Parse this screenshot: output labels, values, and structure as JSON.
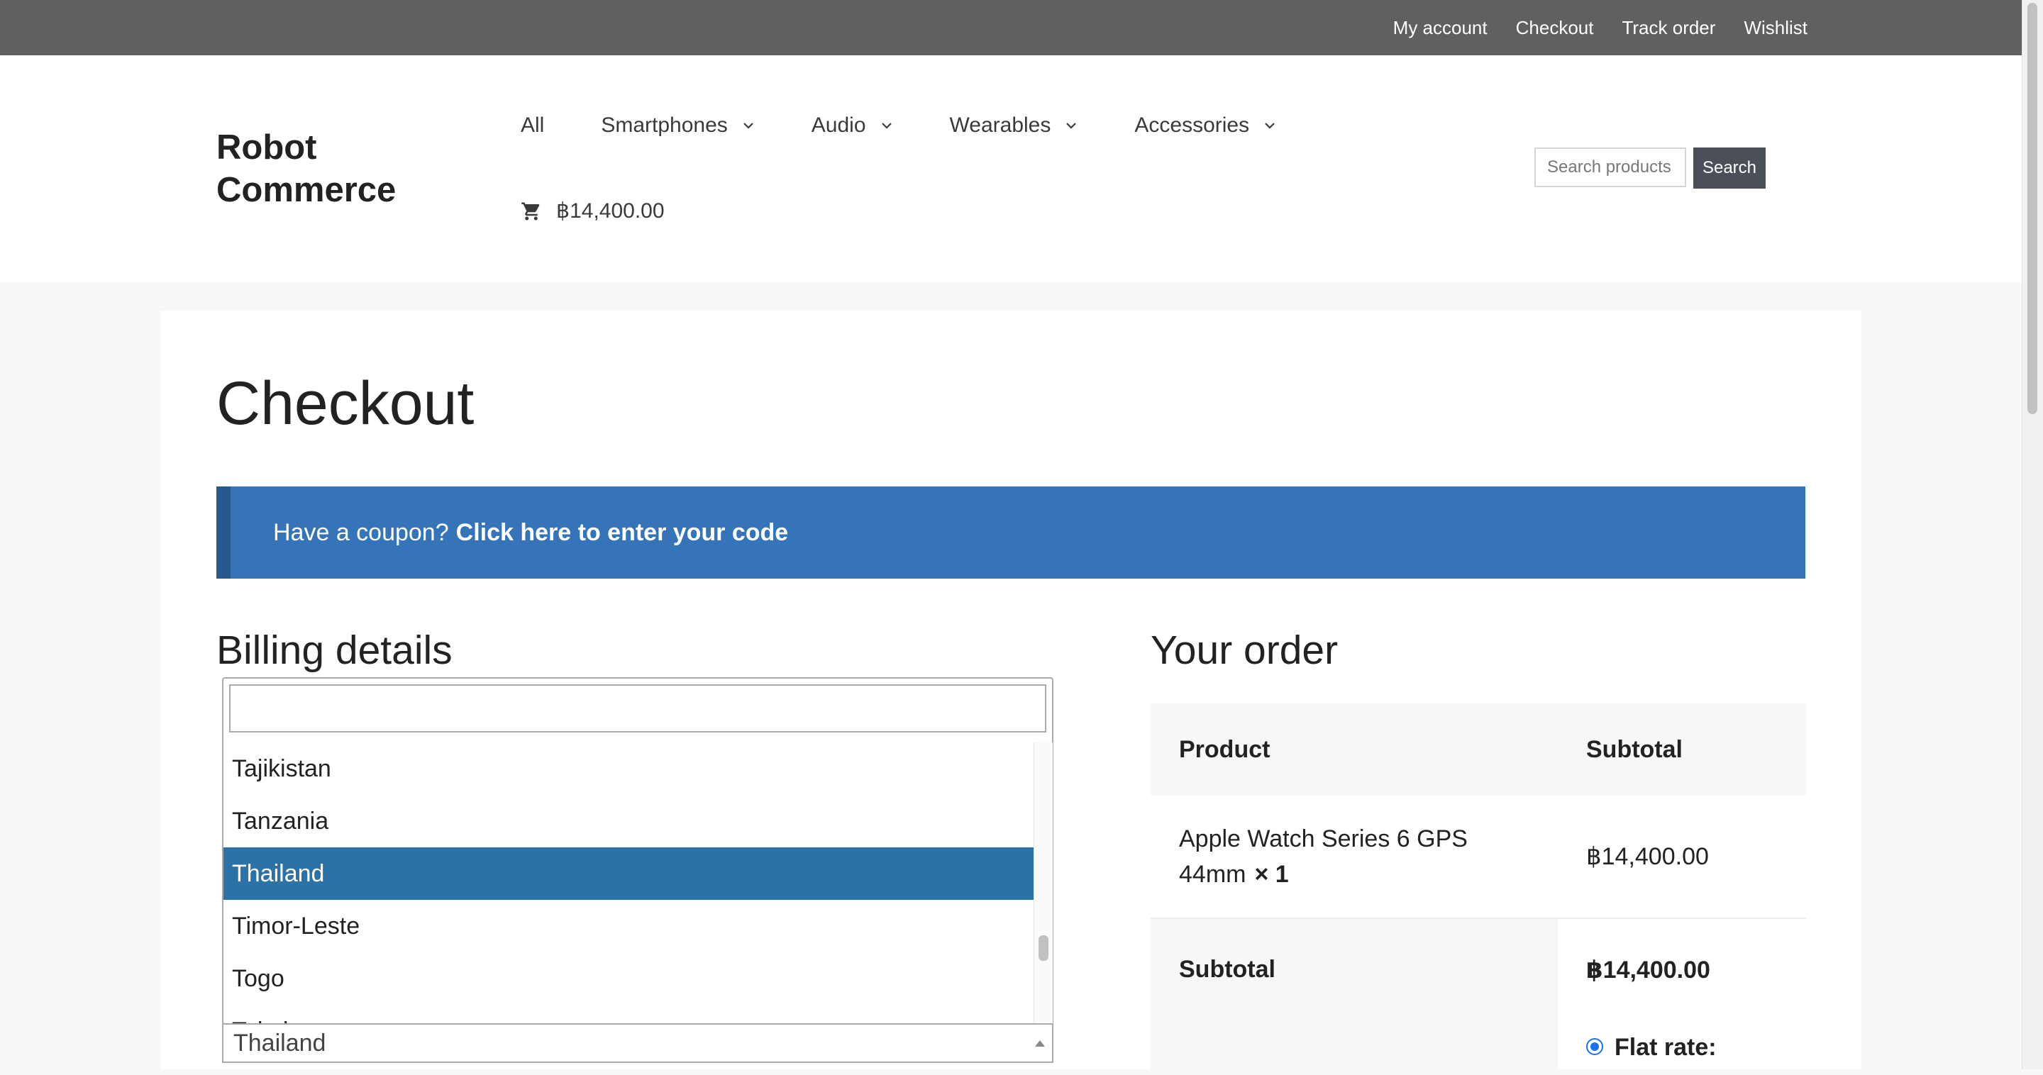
{
  "topbar": {
    "links": [
      "My account",
      "Checkout",
      "Track order",
      "Wishlist"
    ]
  },
  "site": {
    "logo_line1": "Robot",
    "logo_line2": "Commerce"
  },
  "nav": {
    "items": [
      {
        "label": "All",
        "has_dropdown": false
      },
      {
        "label": "Smartphones",
        "has_dropdown": true
      },
      {
        "label": "Audio",
        "has_dropdown": true
      },
      {
        "label": "Wearables",
        "has_dropdown": true
      },
      {
        "label": "Accessories",
        "has_dropdown": true
      }
    ],
    "cart_total": "฿14,400.00"
  },
  "search": {
    "placeholder": "Search products…",
    "button": "Search"
  },
  "page": {
    "title": "Checkout"
  },
  "coupon": {
    "prefix": "Have a coupon?",
    "link": "Click here to enter your code"
  },
  "billing": {
    "title": "Billing details",
    "country_dropdown": {
      "search_value": "",
      "options": [
        "Tajikistan",
        "Tanzania",
        "Thailand",
        "Timor-Leste",
        "Togo",
        "Tokelau"
      ],
      "highlighted": "Thailand"
    },
    "country_selected": "Thailand"
  },
  "order": {
    "title": "Your order",
    "headers": {
      "product": "Product",
      "subtotal": "Subtotal"
    },
    "items": [
      {
        "name": "Apple Watch Series 6 GPS 44mm",
        "qty": "× 1",
        "total": "฿14,400.00"
      }
    ],
    "subtotal_label": "Subtotal",
    "subtotal_value": "฿14,400.00",
    "shipping_option": "Flat rate:"
  }
}
